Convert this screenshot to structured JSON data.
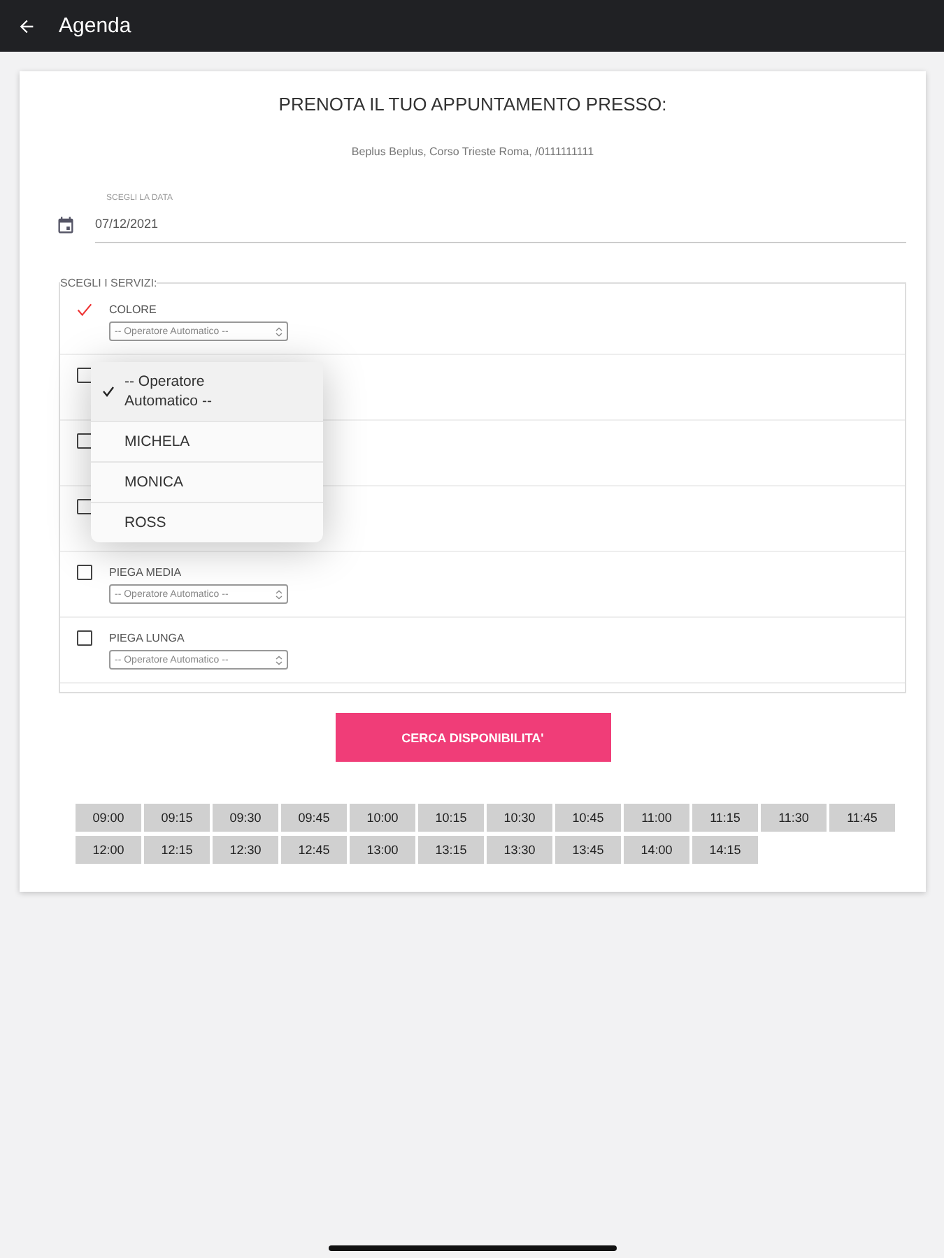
{
  "app_bar": {
    "title": "Agenda"
  },
  "heading": "PRENOTA IL TUO APPUNTAMENTO PRESSO:",
  "address": "Beplus Beplus, Corso Trieste Roma, /0111111111",
  "date_field": {
    "label": "SCEGLI LA DATA",
    "value": "07/12/2021"
  },
  "services": {
    "legend": "SCEGLI I SERVIZI:",
    "items": [
      {
        "name": "COLORE",
        "checked": true,
        "operator": "-- Operatore Automatico -- "
      },
      {
        "checked": false
      },
      {
        "checked": false
      },
      {
        "checked": false
      },
      {
        "name": "PIEGA MEDIA",
        "checked": false,
        "operator": "-- Operatore Automatico -- "
      },
      {
        "name": "PIEGA LUNGA",
        "checked": false,
        "operator": "-- Operatore Automatico -- "
      }
    ]
  },
  "operator_menu": [
    {
      "label": "-- Operatore Automatico --",
      "selected": true
    },
    {
      "label": "MICHELA",
      "selected": false
    },
    {
      "label": "MONICA",
      "selected": false
    },
    {
      "label": "ROSS",
      "selected": false
    }
  ],
  "search_button": "CERCA DISPONIBILITA'",
  "time_slots": [
    "09:00",
    "09:15",
    "09:30",
    "09:45",
    "10:00",
    "10:15",
    "10:30",
    "10:45",
    "11:00",
    "11:15",
    "11:30",
    "11:45",
    "12:00",
    "12:15",
    "12:30",
    "12:45",
    "13:00",
    "13:15",
    "13:30",
    "13:45",
    "14:00",
    "14:15"
  ]
}
